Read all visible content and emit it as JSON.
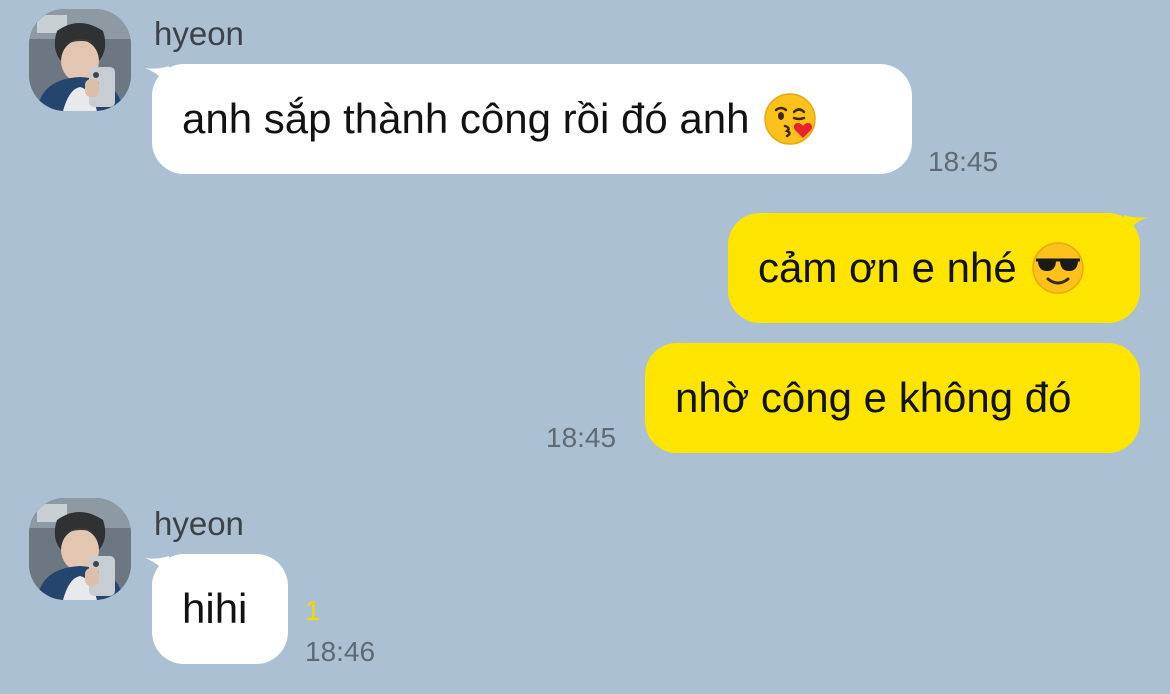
{
  "chat": {
    "messages": [
      {
        "direction": "incoming",
        "sender": "hyeon",
        "text": "anh sắp thành công rồi đó anh",
        "emoji": "kissing-heart-emoji",
        "time": "18:45"
      },
      {
        "direction": "outgoing",
        "text": "cảm ơn e nhé",
        "emoji": "sunglasses-emoji"
      },
      {
        "direction": "outgoing",
        "text": "nhờ công e không đó",
        "time": "18:45"
      },
      {
        "direction": "incoming",
        "sender": "hyeon",
        "text": "hihi",
        "unread_count": "1",
        "time": "18:46"
      }
    ]
  },
  "colors": {
    "background": "#abc0d2",
    "incoming_bubble": "#ffffff",
    "outgoing_bubble": "#fee500",
    "unread": "#f5d800"
  }
}
